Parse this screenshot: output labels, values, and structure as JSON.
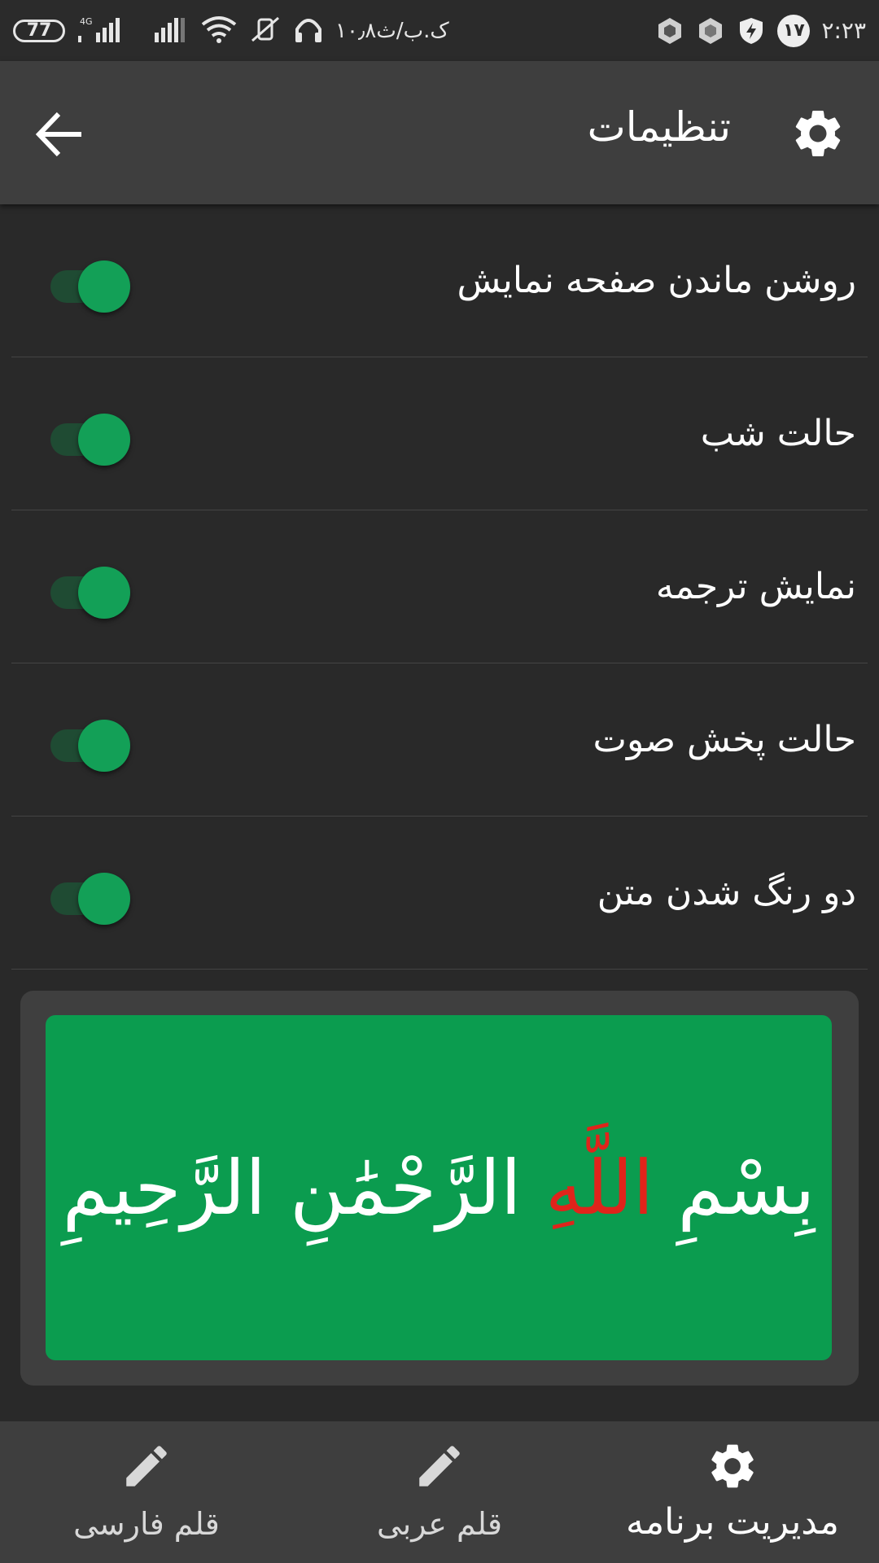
{
  "status_bar": {
    "battery": "77",
    "network_type": "4G",
    "data_speed": "۱۰٫۸ک.ب/ث",
    "notification_count": "۱۷",
    "time": "۲:۲۳"
  },
  "app_bar": {
    "title": "تنظیمات"
  },
  "settings": [
    {
      "label": "روشن ماندن صفحه نمایش",
      "enabled": true
    },
    {
      "label": "حالت شب",
      "enabled": true
    },
    {
      "label": "نمایش ترجمه",
      "enabled": true
    },
    {
      "label": "حالت پخش صوت",
      "enabled": true
    },
    {
      "label": "دو رنگ شدن متن",
      "enabled": true
    }
  ],
  "preview": {
    "word_1": "بِسْمِ",
    "word_2": "اللَّهِ",
    "word_3": "الرَّحْمَٰنِ الرَّحِيمِ",
    "highlight_color": "#e0241b",
    "background_color": "#0b9c4f"
  },
  "bottom_nav": {
    "items": [
      {
        "label": "قلم فارسی",
        "icon": "pencil-icon"
      },
      {
        "label": "قلم عربی",
        "icon": "pencil-icon"
      },
      {
        "label": "مدیریت برنامه",
        "icon": "gear-icon",
        "active": true
      }
    ]
  },
  "colors": {
    "accent": "#13a057",
    "background": "#292929",
    "app_bar": "#3e3e3e"
  }
}
